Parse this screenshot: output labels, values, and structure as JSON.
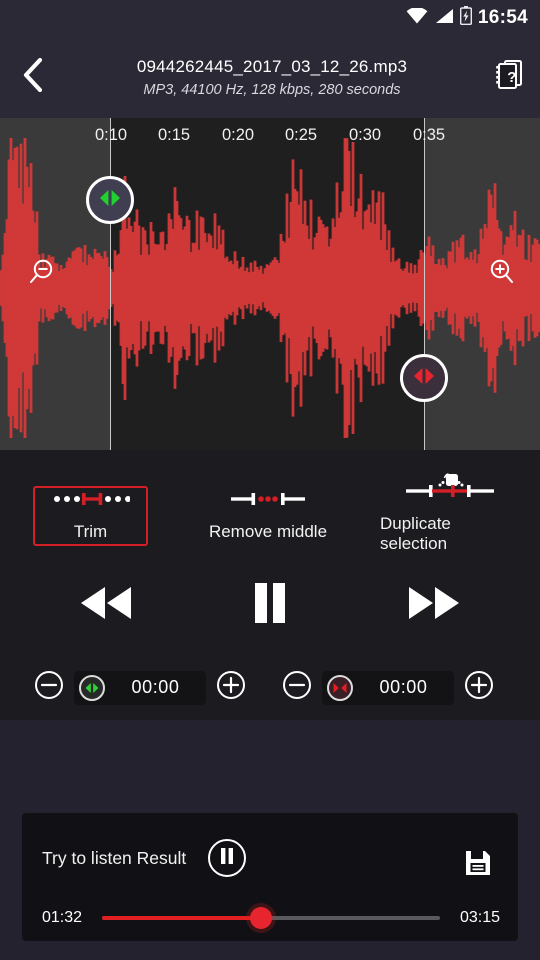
{
  "status_bar": {
    "time": "16:54",
    "icons": [
      "wifi-icon",
      "signal-icon",
      "battery-charging-icon"
    ]
  },
  "header": {
    "back_icon": "chevron-left-icon",
    "file_name": "0944262445_2017_03_12_26.mp3",
    "file_info": "MP3, 44100 Hz, 128 kbps, 280 seconds",
    "help_icon": "help-manual-icon"
  },
  "editor": {
    "zoom_out_icon": "magnifier-minus-icon",
    "zoom_in_icon": "magnifier-plus-icon",
    "ruler_ticks": [
      "0:10",
      "0:15",
      "0:20",
      "0:25",
      "0:30",
      "0:35"
    ],
    "start_handle_icon": "selection-start-handle-icon",
    "end_handle_icon": "selection-end-handle-icon",
    "waveform_color": "#d93a3a",
    "selection_bg": "#1f1f1f",
    "outside_bg": "#3a3a3a"
  },
  "tools": {
    "selected": "Trim",
    "accent": "#d41f26",
    "items": [
      {
        "id": "trim",
        "label": "Trim",
        "icon": "trim-icon"
      },
      {
        "id": "remove-middle",
        "label": "Remove middle",
        "icon": "remove-middle-icon"
      },
      {
        "id": "duplicate-selection",
        "label": "Duplicate selection",
        "icon": "duplicate-selection-icon"
      }
    ]
  },
  "transport": {
    "rewind_icon": "rewind-icon",
    "pause_icon": "pause-icon",
    "forward_icon": "fast-forward-icon"
  },
  "steppers": [
    {
      "id": "start",
      "minus_icon": "minus-circle-icon",
      "badge_icon": "selection-start-handle-icon",
      "badge_color": "#2fd139",
      "value": "00:00",
      "plus_icon": "plus-circle-icon"
    },
    {
      "id": "end",
      "minus_icon": "minus-circle-icon",
      "badge_icon": "selection-end-handle-icon",
      "badge_color": "#e02020",
      "value": "00:00",
      "plus_icon": "plus-circle-icon"
    }
  ],
  "player": {
    "label": "Try to listen Result",
    "pause_icon": "pause-icon",
    "save_icon": "save-floppy-icon",
    "elapsed": "01:32",
    "total": "03:15",
    "progress_percent": 47,
    "progress_color": "#e02020"
  }
}
